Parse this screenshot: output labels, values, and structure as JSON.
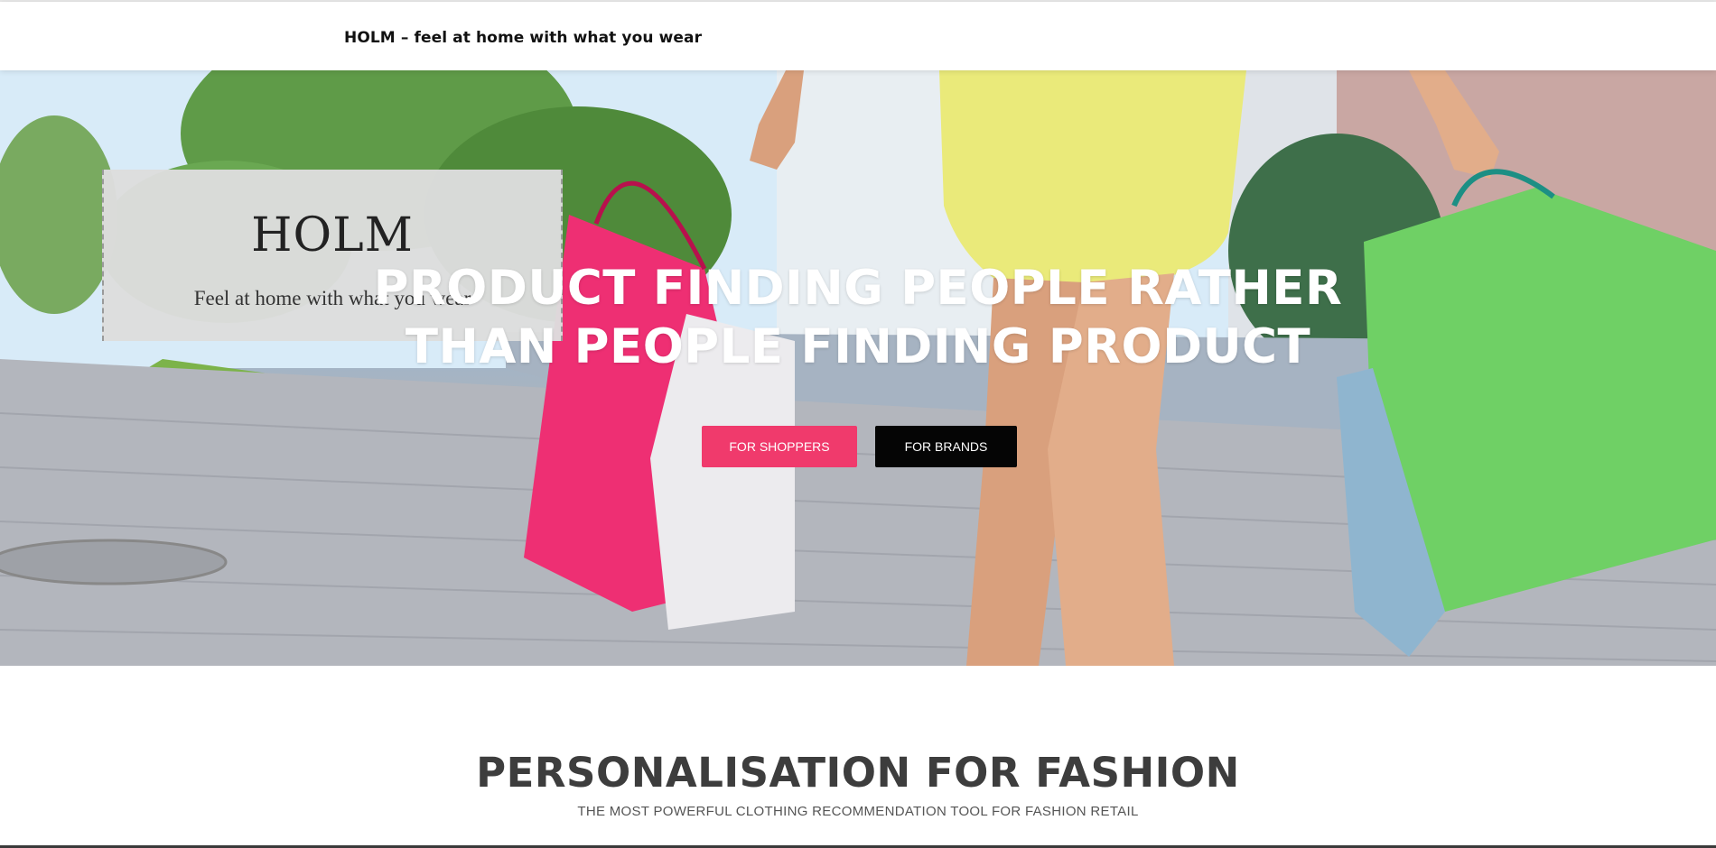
{
  "header": {
    "site_title": "HOLM – feel at home with what you wear"
  },
  "hero": {
    "logo_card": {
      "brand": "HOLM",
      "tagline": "Feel at home with what you wear"
    },
    "headline_line1": "PRODUCT FINDING PEOPLE RATHER",
    "headline_line2": "THAN PEOPLE FINDING PRODUCT",
    "buttons": {
      "shoppers": "FOR SHOPPERS",
      "brands": "FOR BRANDS"
    }
  },
  "section": {
    "title": "PERSONALISATION FOR FASHION",
    "subtitle": "THE MOST POWERFUL CLOTHING RECOMMENDATION TOOL FOR FASHION RETAIL"
  },
  "colors": {
    "shoppers_button": "#f03a6c",
    "brands_button": "#050505",
    "headline_text": "#ffffff",
    "section_title": "#3d3d3d"
  }
}
